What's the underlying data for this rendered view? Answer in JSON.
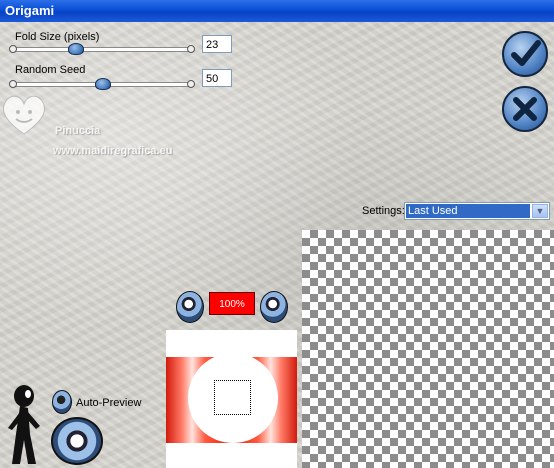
{
  "window": {
    "title": "Origami"
  },
  "controls": {
    "fold_size": {
      "label": "Fold Size (pixels)",
      "value": "23",
      "level": 0.34
    },
    "random_seed": {
      "label": "Random Seed",
      "value": "50",
      "level": 0.5
    }
  },
  "buttons": {
    "ok_icon": "checkmark-icon",
    "cancel_icon": "cancel-x-icon"
  },
  "watermark": {
    "name": "Pinuccia",
    "url": "www.maidiregrafica.eu"
  },
  "settings": {
    "label": "Settings:",
    "selected": "Last Used"
  },
  "zoom": {
    "value": "100%"
  },
  "auto_preview": {
    "label": "Auto-Preview"
  },
  "colors": {
    "titlebar": "#0a4ed6",
    "zoom_box": "#ff0000",
    "select_highlight": "#316ac5"
  }
}
